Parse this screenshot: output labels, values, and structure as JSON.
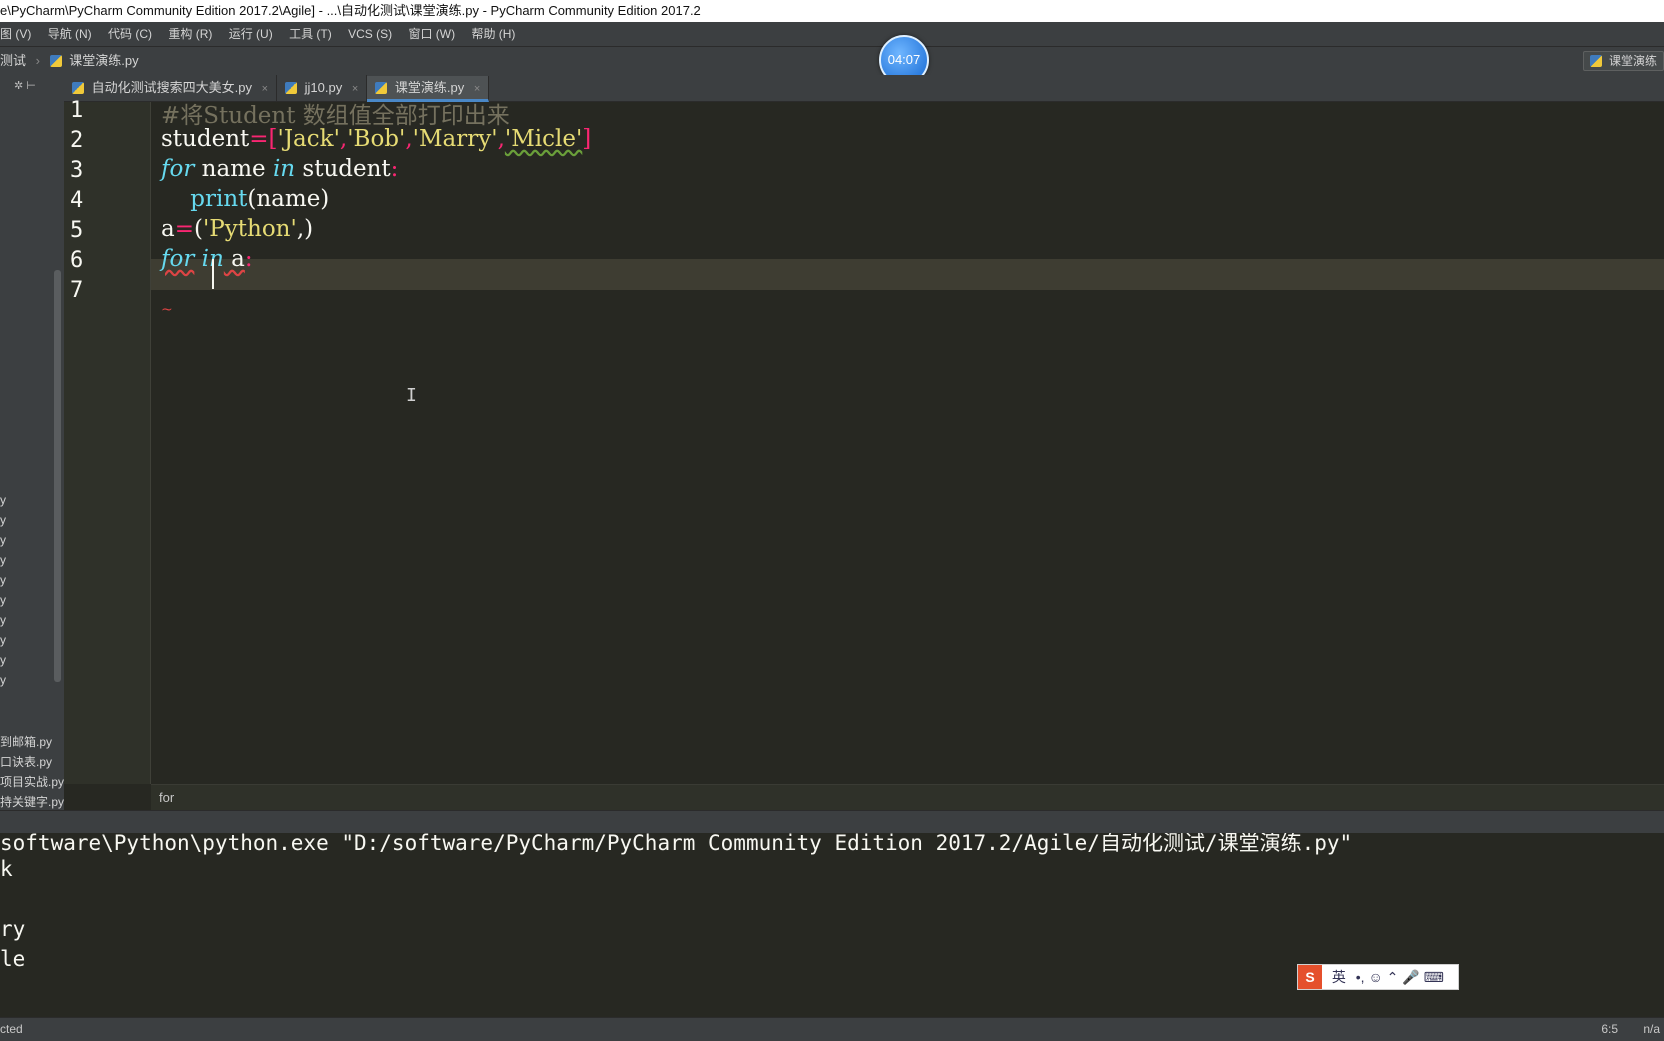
{
  "window": {
    "title": "e\\PyCharm\\PyCharm Community Edition 2017.2\\Agile] - ...\\自动化测试\\课堂演练.py - PyCharm Community Edition 2017.2"
  },
  "menu": {
    "items": [
      "图 (V)",
      "导航 (N)",
      "代码 (C)",
      "重构 (R)",
      "运行 (U)",
      "工具 (T)",
      "VCS (S)",
      "窗口 (W)",
      "帮助 (H)"
    ]
  },
  "navbar": {
    "crumb_folder": "测试",
    "crumb_file": "课堂演练.py",
    "run_config": "课堂演练"
  },
  "timer": {
    "value": "04:07"
  },
  "sidebar": {
    "items": [
      "y",
      "y",
      "y",
      "y",
      "y",
      "y",
      "y",
      "y",
      "y",
      "y",
      "到邮箱.py",
      "口诀表.py",
      "项目实战.py",
      "持关键字.py"
    ]
  },
  "tabs": [
    {
      "label": "自动化测试搜索四大美女.py",
      "close": "×"
    },
    {
      "label": "jj10.py",
      "close": "×"
    },
    {
      "label": "课堂演练.py",
      "close": "×"
    }
  ],
  "editor": {
    "line_numbers": [
      "1",
      "2",
      "3",
      "4",
      "5",
      "6",
      "7"
    ],
    "line1": {
      "comment": "#将Student 数组值全部打印出来"
    },
    "line2": {
      "var": "student",
      "eq": "=",
      "lb": "[",
      "s1": "'Jack'",
      "c1": ",",
      "s2": "'Bob'",
      "c2": ",",
      "s3": "'Marry'",
      "c3": ",",
      "s4": "'Micle'",
      "rb": "]"
    },
    "line3": {
      "kw_for": "for",
      "name": " name ",
      "kw_in": "in",
      "target": " student",
      "colon": ":"
    },
    "line4": {
      "indent": "    ",
      "fn": "print",
      "args": "(name)"
    },
    "line5": {
      "var": "a",
      "eq": "=",
      "lp": "(",
      "str": "'Python'",
      "rest": ",)"
    },
    "line6": {
      "kw_for": "for",
      "space": " ",
      "kw_in": "in",
      "target": " a",
      "colon": ":"
    },
    "squiggle": "~"
  },
  "breadcrumb": {
    "text": "for"
  },
  "console": {
    "lines": [
      "software\\Python\\python.exe \"D:/software/PyCharm/PyCharm Community Edition 2017.2/Agile/自动化测试/课堂演练.py\"",
      "k",
      "",
      "ry",
      "le"
    ]
  },
  "ime": {
    "logo": "S",
    "lang": "英",
    "glyphs": "•, ☺ ⌃ 🎤 ⌨"
  },
  "status": {
    "message": "cted",
    "position": "6:5",
    "encoding": "n/a"
  }
}
